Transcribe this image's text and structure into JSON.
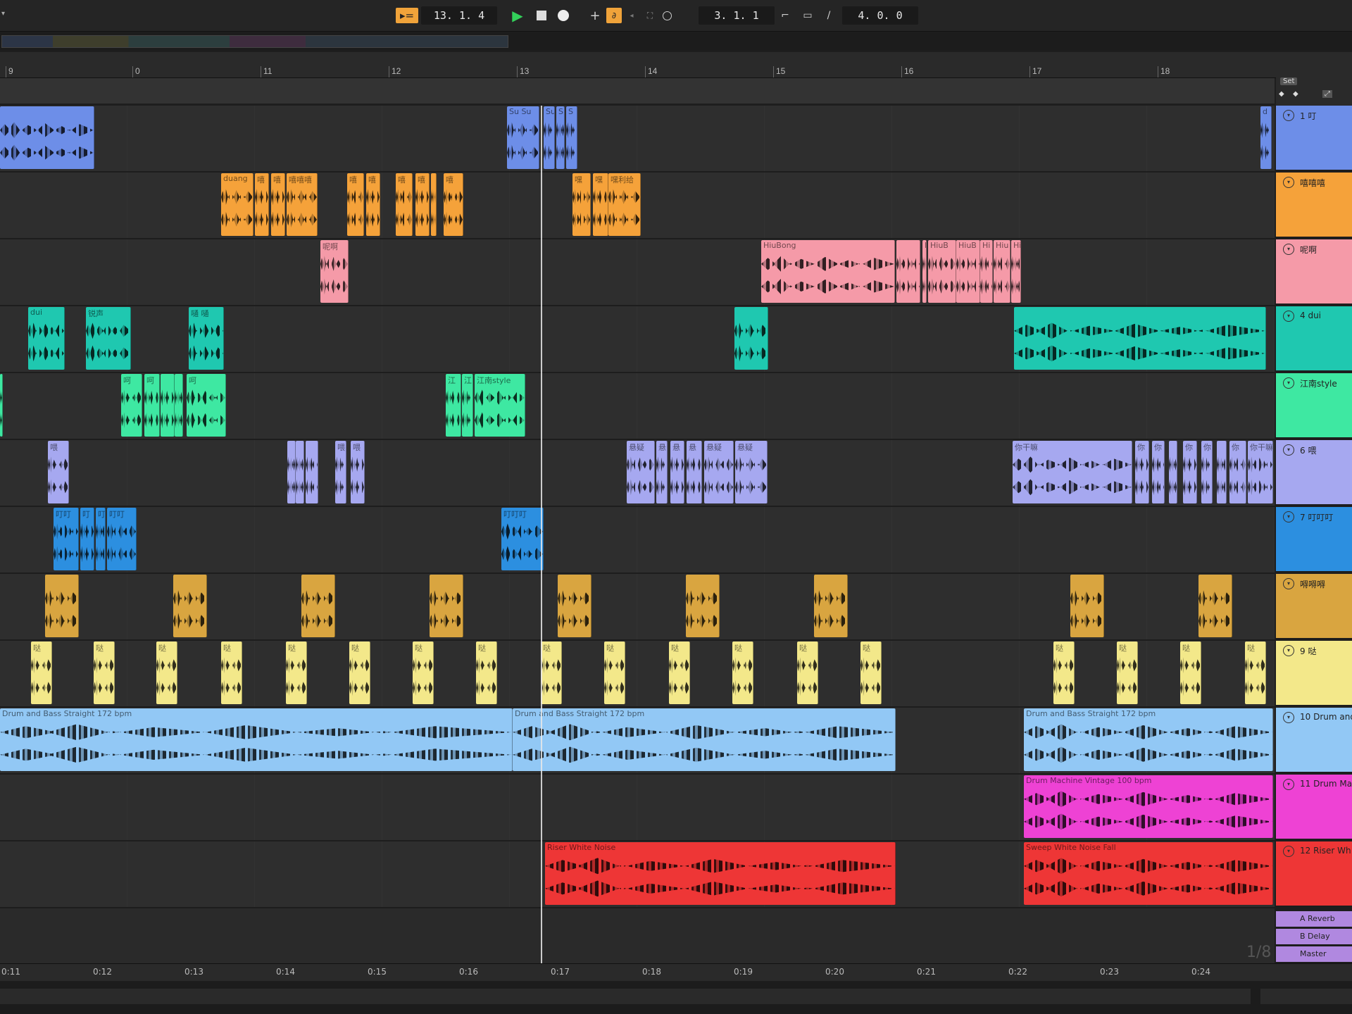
{
  "transport": {
    "position": "13.  1.  4",
    "loop_start": "3.  1.  1",
    "loop_length": "4.  0.  0",
    "set_label": "Set"
  },
  "ruler_bars": [
    "9",
    "0",
    "11",
    "12",
    "13",
    "14",
    "15",
    "16",
    "17",
    "18"
  ],
  "time_ticks": [
    "0:11",
    "0:12",
    "0:13",
    "0:14",
    "0:15",
    "0:16",
    "0:17",
    "0:18",
    "0:19",
    "0:20",
    "0:21",
    "0:22",
    "0:23",
    "0:24"
  ],
  "colors": {
    "blue": "#6d8ee8",
    "orange": "#f5a23a",
    "pink": "#f59aa8",
    "teal": "#1fc8b0",
    "green": "#3ee8a2",
    "lavender": "#a6a8f0",
    "deepblue": "#2c8fe0",
    "gold": "#d9a540",
    "yellow": "#f3e88a",
    "skyblue": "#92c8f5",
    "magenta": "#ee42d4",
    "red": "#ee3636",
    "returns": "#b088e0"
  },
  "tracks": [
    {
      "header": "1 叮",
      "color": "blue",
      "clips": [
        [
          0,
          134,
          ""
        ],
        [
          720,
          46,
          "Su Su"
        ],
        [
          772,
          16,
          "Su"
        ],
        [
          790,
          12,
          "S"
        ],
        [
          804,
          16,
          "S"
        ],
        [
          1790,
          16,
          "d"
        ]
      ]
    },
    {
      "header": "嘻嘻嘻",
      "color": "orange",
      "clips": [
        [
          314,
          46,
          "duang"
        ],
        [
          362,
          20,
          "嘻"
        ],
        [
          385,
          20,
          "嘻"
        ],
        [
          407,
          44,
          "嘻嘻嘻"
        ],
        [
          493,
          24,
          "嘻"
        ],
        [
          520,
          20,
          "嘻"
        ],
        [
          562,
          24,
          "嘻"
        ],
        [
          590,
          20,
          "嘻"
        ],
        [
          612,
          8,
          ""
        ],
        [
          630,
          28,
          "嘻"
        ],
        [
          813,
          26,
          "嘿"
        ],
        [
          842,
          22,
          "嘿"
        ],
        [
          864,
          46,
          "嘿利给"
        ]
      ]
    },
    {
      "header": "呢啊",
      "color": "pink",
      "clips": [
        [
          455,
          40,
          "呢啊"
        ],
        [
          1081,
          190,
          "HiuBong"
        ],
        [
          1273,
          34,
          ""
        ],
        [
          1310,
          6,
          "H"
        ],
        [
          1318,
          40,
          "HiuB"
        ],
        [
          1358,
          34,
          "HiuB"
        ],
        [
          1392,
          18,
          "Hi"
        ],
        [
          1411,
          24,
          "Hiu"
        ],
        [
          1436,
          14,
          "Hi"
        ]
      ]
    },
    {
      "header": "4 dui",
      "color": "teal",
      "clips": [
        [
          40,
          52,
          "dui"
        ],
        [
          122,
          64,
          "锐声"
        ],
        [
          268,
          50,
          "嗵 嗵"
        ],
        [
          1043,
          48,
          ""
        ],
        [
          1440,
          358,
          ""
        ]
      ]
    },
    {
      "header": "江南style",
      "color": "green",
      "clips": [
        [
          0,
          4,
          ""
        ],
        [
          172,
          30,
          "呵"
        ],
        [
          205,
          22,
          "呵"
        ],
        [
          228,
          20,
          ""
        ],
        [
          248,
          12,
          ""
        ],
        [
          265,
          56,
          "呵"
        ],
        [
          633,
          22,
          "江"
        ],
        [
          656,
          16,
          "江"
        ],
        [
          674,
          72,
          "江南style"
        ]
      ]
    },
    {
      "header": "6 喂",
      "color": "lavender",
      "clips": [
        [
          68,
          30,
          "喂"
        ],
        [
          408,
          12,
          ""
        ],
        [
          420,
          12,
          ""
        ],
        [
          434,
          18,
          ""
        ],
        [
          476,
          16,
          "喂"
        ],
        [
          498,
          20,
          "喂"
        ],
        [
          890,
          40,
          "悬疑"
        ],
        [
          932,
          16,
          "悬"
        ],
        [
          952,
          20,
          "悬"
        ],
        [
          975,
          22,
          "悬"
        ],
        [
          1000,
          42,
          "悬疑"
        ],
        [
          1044,
          46,
          "悬疑"
        ],
        [
          1438,
          170,
          "你干嘛"
        ],
        [
          1612,
          20,
          "你"
        ],
        [
          1636,
          18,
          "你"
        ],
        [
          1660,
          12,
          ""
        ],
        [
          1680,
          20,
          "你"
        ],
        [
          1706,
          16,
          "你"
        ],
        [
          1728,
          14,
          ""
        ],
        [
          1746,
          24,
          "你"
        ],
        [
          1772,
          36,
          "你干嘛"
        ]
      ]
    },
    {
      "header": "7 叮叮叮",
      "color": "deepblue",
      "clips": [
        [
          76,
          36,
          "叮叮"
        ],
        [
          114,
          20,
          "叮"
        ],
        [
          136,
          14,
          "叮"
        ],
        [
          152,
          42,
          "叮叮"
        ],
        [
          712,
          60,
          "叮叮叮"
        ]
      ]
    },
    {
      "header": "嘚嘚嘚",
      "color": "gold",
      "clips": [
        [
          64,
          48,
          ""
        ],
        [
          246,
          48,
          ""
        ],
        [
          428,
          48,
          ""
        ],
        [
          610,
          48,
          ""
        ],
        [
          792,
          48,
          ""
        ],
        [
          974,
          48,
          ""
        ],
        [
          1156,
          48,
          ""
        ],
        [
          1520,
          48,
          ""
        ],
        [
          1702,
          48,
          ""
        ]
      ]
    },
    {
      "header": "9 哒",
      "color": "yellow",
      "clips": [
        [
          44,
          30,
          "哒"
        ],
        [
          133,
          30,
          "哒"
        ],
        [
          222,
          30,
          "哒"
        ],
        [
          314,
          30,
          "哒"
        ],
        [
          406,
          30,
          "哒"
        ],
        [
          496,
          30,
          "哒"
        ],
        [
          586,
          30,
          "哒"
        ],
        [
          676,
          30,
          "哒"
        ],
        [
          768,
          30,
          "哒"
        ],
        [
          858,
          30,
          "哒"
        ],
        [
          950,
          30,
          "哒"
        ],
        [
          1040,
          30,
          "哒"
        ],
        [
          1132,
          30,
          "哒"
        ],
        [
          1222,
          30,
          "哒"
        ],
        [
          1496,
          30,
          "哒"
        ],
        [
          1586,
          30,
          "哒"
        ],
        [
          1676,
          30,
          "哒"
        ],
        [
          1768,
          30,
          "哒"
        ]
      ]
    },
    {
      "header": "10 Drum and",
      "color": "skyblue",
      "clips": [
        [
          0,
          728,
          "Drum and Bass Straight 172 bpm"
        ],
        [
          728,
          544,
          "Drum and Bass Straight 172 bpm"
        ],
        [
          1454,
          354,
          "Drum and Bass Straight 172 bpm"
        ]
      ]
    },
    {
      "header": "11 Drum Ma",
      "color": "magenta",
      "clips": [
        [
          1454,
          354,
          "Drum Machine Vintage 100 bpm"
        ]
      ]
    },
    {
      "header": "12 Riser Wh",
      "color": "red",
      "clips": [
        [
          774,
          498,
          "Riser White Noise"
        ],
        [
          1454,
          354,
          "Sweep White Noise Fall"
        ]
      ]
    }
  ],
  "returns": [
    "A Reverb",
    "B Delay",
    "Master"
  ],
  "overlay_text": "1/8"
}
